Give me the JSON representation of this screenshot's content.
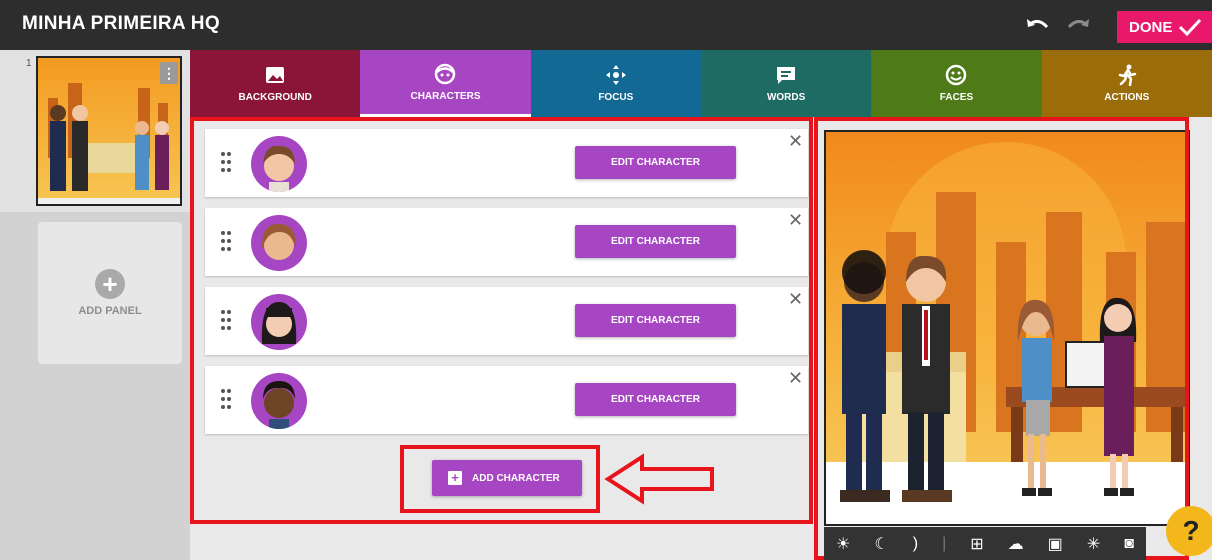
{
  "header": {
    "title": "MINHA PRIMEIRA HQ",
    "done_label": "DONE"
  },
  "panels": {
    "items": [
      {
        "number": "1"
      }
    ],
    "add_label": "ADD PANEL"
  },
  "tabs": [
    {
      "label": "BACKGROUND",
      "color": "#8a1538",
      "icon": "image-icon"
    },
    {
      "label": "CHARACTERS",
      "color": "#a746c3",
      "icon": "character-face-icon"
    },
    {
      "label": "FOCUS",
      "color": "#126a94",
      "icon": "focus-arrows-icon"
    },
    {
      "label": "WORDS",
      "color": "#1d6b63",
      "icon": "speech-bubble-icon"
    },
    {
      "label": "FACES",
      "color": "#4e7a17",
      "icon": "smiley-icon"
    },
    {
      "label": "ACTIONS",
      "color": "#9b6c0a",
      "icon": "running-person-icon"
    }
  ],
  "characters": {
    "edit_label": "EDIT CHARACTER",
    "add_label": "ADD CHARACTER",
    "items": [
      {
        "name": "character-1",
        "skin": "#f3c7a6",
        "hair": "#7a4a2a"
      },
      {
        "name": "character-2",
        "skin": "#eab98f",
        "hair": "#9b5a36"
      },
      {
        "name": "character-3",
        "skin": "#f2cdb3",
        "hair": "#1f1a1a"
      },
      {
        "name": "character-4",
        "skin": "#6e4426",
        "hair": "#1a1310"
      }
    ]
  },
  "toolbar": {
    "icons": [
      "brightness-icon",
      "moon-icon",
      "crescent-icon",
      "add-frame-icon",
      "cloud-icon",
      "picture-icon",
      "sparkle-icon",
      "camera-icon"
    ]
  },
  "colors": {
    "accent": "#a746c3",
    "done": "#e8196b",
    "annotation": "#e8141c"
  }
}
